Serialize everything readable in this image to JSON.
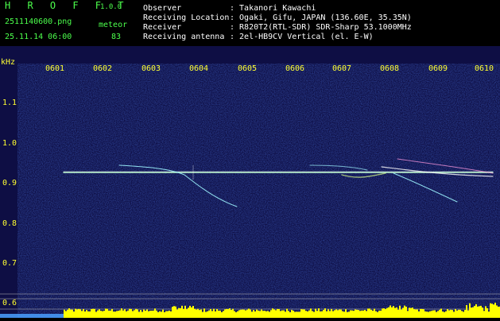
{
  "header": {
    "app_title": "H R O F F T",
    "version": "1.0.0",
    "filename": "2511140600.png",
    "datetime": "25.11.14 06:00",
    "event_label": "meteor",
    "event_count": "83",
    "info": {
      "observer_label": "Observer",
      "observer_value": ": Takanori Kawachi",
      "location_label": "Receiving Location",
      "location_value": ": Ogaki, Gifu, JAPAN (136.60E, 35.35N)",
      "receiver_label": "Receiver",
      "receiver_value": ": R820T2(RTL-SDR) SDR-Sharp 53.1000MHz",
      "antenna_label": "Receiving antenna",
      "antenna_value": ": 2el-HB9CV Vertical (el. E-W)"
    }
  },
  "spectrogram": {
    "y_unit": "kHz",
    "y_ticks": [
      "1.1",
      "1.0",
      "0.9",
      "0.8",
      "0.7",
      "0.6"
    ],
    "x_ticks": [
      "0601",
      "0602",
      "0603",
      "0604",
      "0605",
      "0606",
      "0607",
      "0608",
      "0609",
      "0610"
    ],
    "colors": {
      "background": "#10104a",
      "trace": "#e8ffe8",
      "level_bar": "#ffff00",
      "axis_text": "#ffff33"
    }
  }
}
